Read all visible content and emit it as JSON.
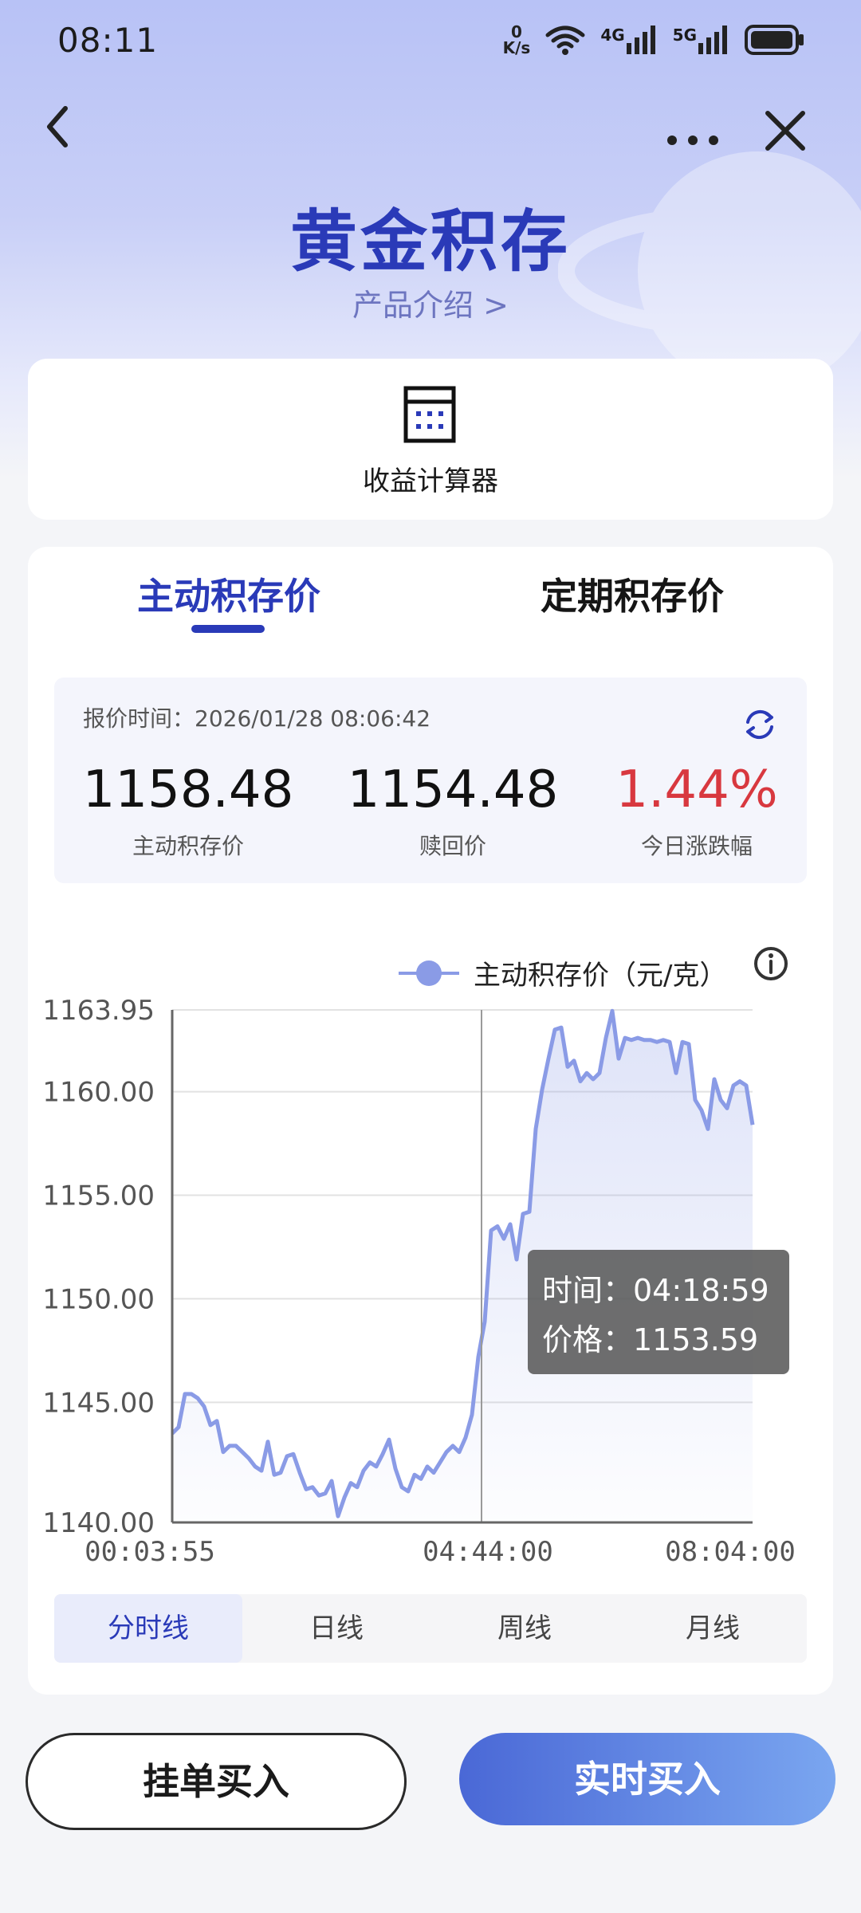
{
  "status_bar": {
    "time": "08:11",
    "net_speed_value": "0",
    "net_speed_unit": "K/s",
    "net1": "4G",
    "net2": "5G"
  },
  "header": {
    "title": "黄金积存",
    "subtitle": "产品介绍 >"
  },
  "calculator": {
    "label": "收益计算器"
  },
  "tabs": [
    {
      "label": "主动积存价",
      "active": true
    },
    {
      "label": "定期积存价",
      "active": false
    }
  ],
  "quote": {
    "time_label": "报价时间：2026/01/28 08:06:42",
    "items": [
      {
        "value": "1158.48",
        "label": "主动积存价"
      },
      {
        "value": "1154.48",
        "label": "赎回价"
      },
      {
        "value": "1.44%",
        "label": "今日涨跌幅"
      }
    ]
  },
  "chart_data": {
    "type": "line",
    "series": [
      {
        "name": "主动积存价（元/克）",
        "y": [
          1143.5,
          1143.8,
          1145.4,
          1145.4,
          1145.2,
          1144.8,
          1143.9,
          1144.1,
          1142.6,
          1142.9,
          1142.9,
          1142.6,
          1142.3,
          1141.9,
          1141.7,
          1143.1,
          1141.5,
          1141.6,
          1142.4,
          1142.5,
          1141.6,
          1140.8,
          1140.9,
          1140.5,
          1140.6,
          1141.2,
          1139.5,
          1140.4,
          1141.1,
          1140.9,
          1141.7,
          1142.1,
          1141.9,
          1142.5,
          1143.2,
          1141.8,
          1140.9,
          1140.7,
          1141.5,
          1141.3,
          1141.9,
          1141.6,
          1142.1,
          1142.6,
          1142.9,
          1142.6,
          1143.3,
          1144.4,
          1147.2,
          1148.9,
          1153.3,
          1153.5,
          1152.9,
          1153.6,
          1151.9,
          1154.1,
          1154.2,
          1158.2,
          1160.1,
          1161.6,
          1163.0,
          1163.1,
          1161.2,
          1161.5,
          1160.5,
          1160.9,
          1160.6,
          1160.9,
          1162.6,
          1163.9,
          1161.6,
          1162.6,
          1162.5,
          1162.6,
          1162.5,
          1162.5,
          1162.4,
          1162.5,
          1162.4,
          1160.9,
          1162.4,
          1162.3,
          1159.6,
          1159.1,
          1158.2,
          1160.6,
          1159.6,
          1159.2,
          1160.3,
          1160.5,
          1160.3,
          1158.4
        ]
      }
    ],
    "x_tick_labels": [
      "00:03:55",
      "04:44:00",
      "08:04:00"
    ],
    "y_tick_labels": [
      "1163.95",
      "1160.00",
      "1155.00",
      "1150.00",
      "1145.00",
      "1140.00"
    ],
    "ylim": [
      1139.2,
      1163.95
    ],
    "grid": true,
    "legend": "top-right",
    "crosshair_time": "04:44:00",
    "tooltip": {
      "time": "时间：04:18:59",
      "price": "价格：1153.59"
    },
    "color": "#8a9be6"
  },
  "periods": [
    {
      "label": "分时线",
      "active": true
    },
    {
      "label": "日线",
      "active": false
    },
    {
      "label": "周线",
      "active": false
    },
    {
      "label": "月线",
      "active": false
    }
  ],
  "actions": {
    "pending_buy": "挂单买入",
    "realtime_buy": "实时买入"
  },
  "colors": {
    "brand": "#2a3ab8",
    "rise": "#d8383f",
    "line": "#8a9be6"
  }
}
